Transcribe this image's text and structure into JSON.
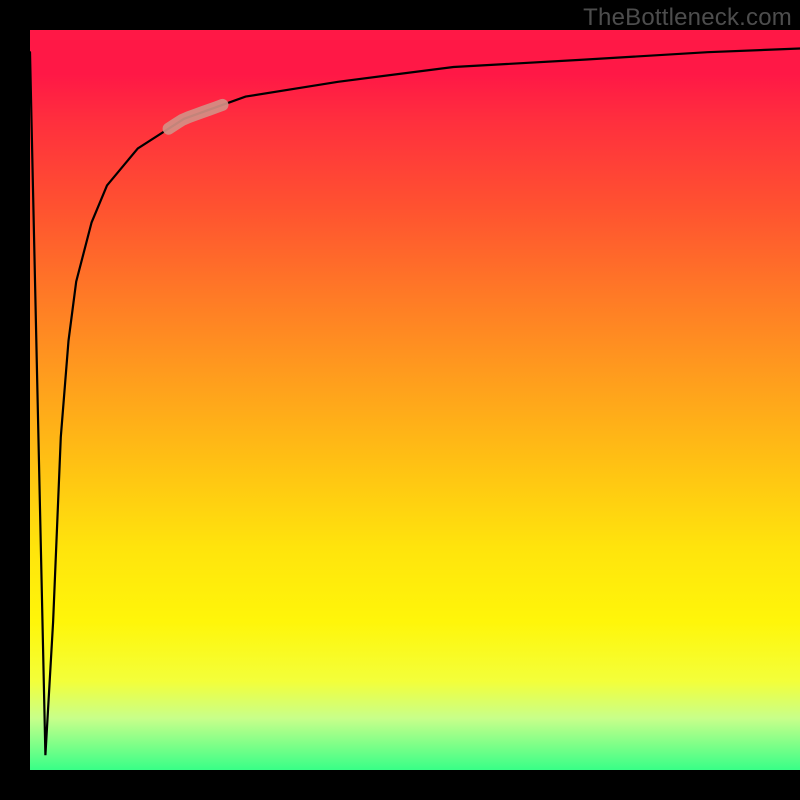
{
  "watermark": "TheBottleneck.com",
  "chart_data": {
    "type": "line",
    "title": "",
    "xlabel": "",
    "ylabel": "",
    "xlim": [
      0,
      100
    ],
    "ylim": [
      0,
      100
    ],
    "background_gradient": {
      "direction": "vertical",
      "colors": [
        "#ff1846",
        "#ff7a26",
        "#ffe40c",
        "#38ff87"
      ]
    },
    "series": [
      {
        "name": "curve",
        "description": "Sharp dip to 0 near the left edge then logarithmic rise toward the top-right.",
        "x": [
          0,
          2,
          3,
          4,
          5,
          6,
          8,
          10,
          14,
          20,
          28,
          40,
          55,
          72,
          88,
          100
        ],
        "y": [
          97,
          2,
          20,
          45,
          58,
          66,
          74,
          79,
          84,
          88,
          91,
          93,
          95,
          96,
          97,
          97.5
        ]
      }
    ],
    "marker": {
      "description": "Short highlighted segment on the curve in the upper-left region.",
      "x_range": [
        18,
        25
      ],
      "y_range": [
        86,
        90
      ],
      "color": "#d48f84"
    }
  }
}
